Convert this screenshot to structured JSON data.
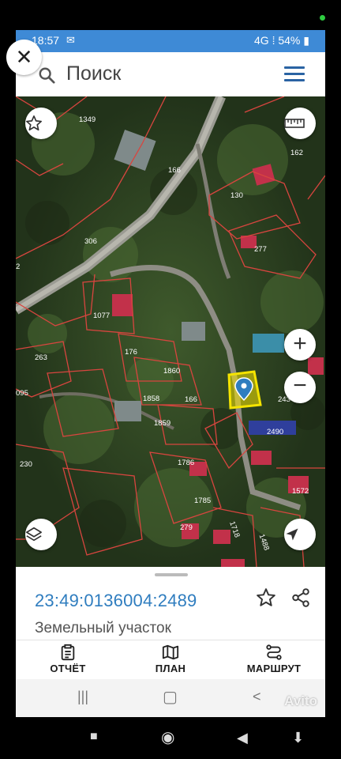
{
  "status": {
    "time": "18:57",
    "mail_icon": "mail-icon",
    "signal": "4G",
    "battery": "54%"
  },
  "search": {
    "placeholder": "Поиск"
  },
  "map_labels": [
    {
      "text": "1349"
    },
    {
      "text": "166"
    },
    {
      "text": "162"
    },
    {
      "text": "130"
    },
    {
      "text": "306"
    },
    {
      "text": "277"
    },
    {
      "text": "2"
    },
    {
      "text": "1077"
    },
    {
      "text": "176"
    },
    {
      "text": "263"
    },
    {
      "text": "1860"
    },
    {
      "text": "095"
    },
    {
      "text": "1858"
    },
    {
      "text": "166"
    },
    {
      "text": "1859"
    },
    {
      "text": "243"
    },
    {
      "text": "2490"
    },
    {
      "text": "230"
    },
    {
      "text": "1786"
    },
    {
      "text": "1785"
    },
    {
      "text": "1572"
    },
    {
      "text": "279"
    },
    {
      "text": "1718"
    },
    {
      "text": "1488"
    }
  ],
  "parcel": {
    "cadastral_number": "23:49:0136004:2489",
    "type": "Земельный участок"
  },
  "actions": [
    {
      "label": "ОТЧЁТ",
      "icon": "report-icon"
    },
    {
      "label": "ПЛАН",
      "icon": "map-plan-icon"
    },
    {
      "label": "МАРШРУТ",
      "icon": "route-icon"
    }
  ],
  "watermark": "Avito",
  "colors": {
    "accent": "#2f7dbf",
    "statusbar": "#3e8ad6",
    "parcel_highlight": "#f5e400",
    "boundary": "#d23a3a"
  }
}
